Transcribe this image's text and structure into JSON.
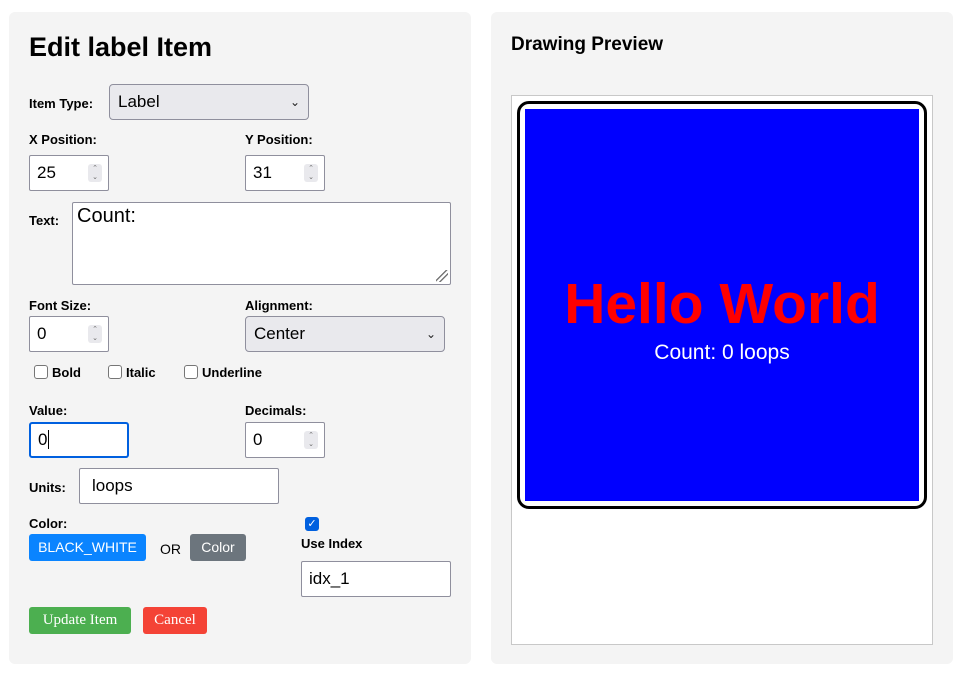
{
  "editor": {
    "title": "Edit label Item",
    "item_type": {
      "label": "Item Type:",
      "value": "Label"
    },
    "x_position": {
      "label": "X Position:",
      "value": "25"
    },
    "y_position": {
      "label": "Y Position:",
      "value": "31"
    },
    "text": {
      "label": "Text:",
      "value": "Count:"
    },
    "font_size": {
      "label": "Font Size:",
      "value": "0"
    },
    "alignment": {
      "label": "Alignment:",
      "value": "Center"
    },
    "checkboxes": [
      {
        "label": "Bold",
        "checked": false
      },
      {
        "label": "Italic",
        "checked": false
      },
      {
        "label": "Underline",
        "checked": false
      }
    ],
    "value": {
      "label": "Value:",
      "value": "0"
    },
    "decimals": {
      "label": "Decimals:",
      "value": "0"
    },
    "units": {
      "label": "Units:",
      "value": "loops"
    },
    "color": {
      "label": "Color:",
      "selected_button": "BLACK_WHITE",
      "or_text": "OR",
      "color_button": "Color"
    },
    "use_index": {
      "label": "Use Index",
      "checked": true,
      "value": "idx_1"
    },
    "update_button": "Update Item",
    "cancel_button": "Cancel"
  },
  "preview": {
    "title": "Drawing Preview",
    "heading_text": "Hello World",
    "label_text": "Count: 0 loops",
    "colors": {
      "background": "#0000ff",
      "heading": "#ff0000",
      "label": "#ffffff"
    }
  }
}
